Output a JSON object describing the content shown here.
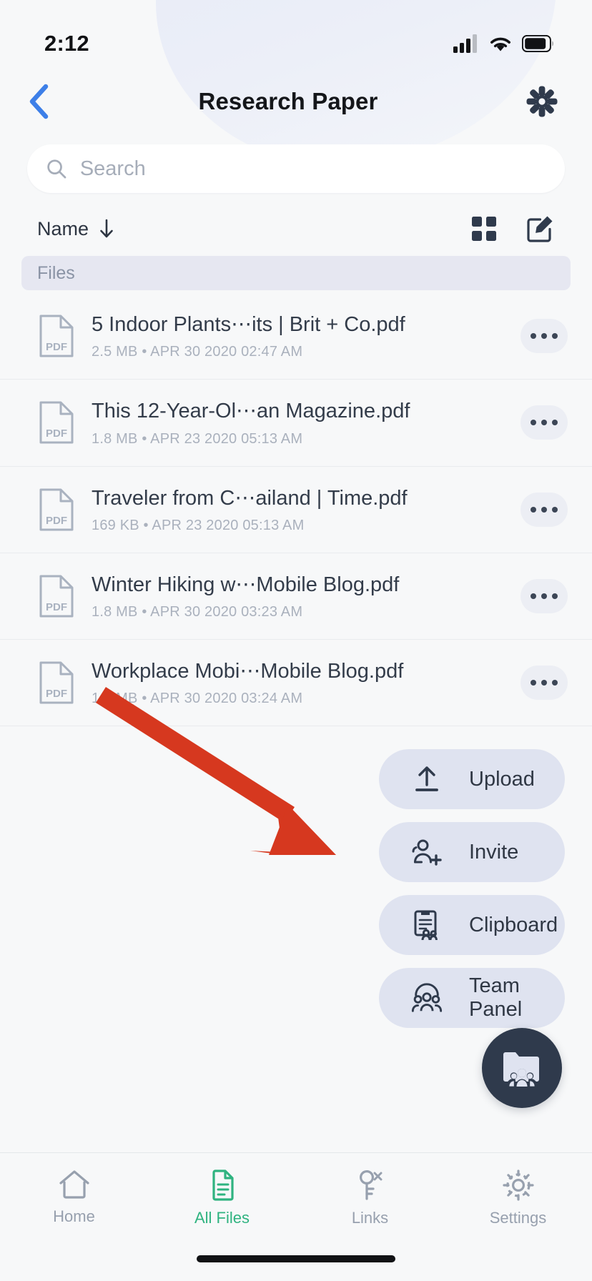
{
  "status_bar": {
    "time": "2:12",
    "cellular_icon": "cellular-signal-icon",
    "wifi_icon": "wifi-icon",
    "battery_icon": "battery-icon"
  },
  "nav": {
    "back_icon": "chevron-left-icon",
    "title": "Research Paper",
    "settings_icon": "gear-icon"
  },
  "search": {
    "placeholder": "Search",
    "value": "",
    "icon": "search-icon"
  },
  "toolbar": {
    "sort_label": "Name",
    "sort_direction_icon": "arrow-down-icon",
    "grid_view_icon": "grid-view-icon",
    "compose_icon": "compose-edit-icon"
  },
  "section": {
    "label": "Files"
  },
  "files": [
    {
      "name": "5 Indoor Plants⋯its | Brit + Co.pdf",
      "size": "2.5 MB",
      "date": "APR 30 2020 02:47 AM",
      "meta": "2.5 MB • APR 30 2020 02:47 AM",
      "type": "PDF",
      "icon": "pdf-file-icon",
      "more_icon": "more-options-icon"
    },
    {
      "name": "This 12-Year-Ol⋯an Magazine.pdf",
      "size": "1.8 MB",
      "date": "APR 23 2020 05:13 AM",
      "meta": "1.8 MB • APR 23 2020 05:13 AM",
      "type": "PDF",
      "icon": "pdf-file-icon",
      "more_icon": "more-options-icon"
    },
    {
      "name": "Traveler from C⋯ailand | Time.pdf",
      "size": "169 KB",
      "date": "APR 23 2020 05:13 AM",
      "meta": "169 KB • APR 23 2020 05:13 AM",
      "type": "PDF",
      "icon": "pdf-file-icon",
      "more_icon": "more-options-icon"
    },
    {
      "name": "Winter Hiking w⋯Mobile Blog.pdf",
      "size": "1.8 MB",
      "date": "APR 30 2020 03:23 AM",
      "meta": "1.8 MB • APR 30 2020 03:23 AM",
      "type": "PDF",
      "icon": "pdf-file-icon",
      "more_icon": "more-options-icon"
    },
    {
      "name": "Workplace Mobi⋯Mobile Blog.pdf",
      "size": "1.2 MB",
      "date": "APR 30 2020 03:24 AM",
      "meta": "1.2 MB • APR 30 2020 03:24 AM",
      "type": "PDF",
      "icon": "pdf-file-icon",
      "more_icon": "more-options-icon"
    }
  ],
  "actions": [
    {
      "label": "Upload",
      "icon": "upload-arrow-icon"
    },
    {
      "label": "Invite",
      "icon": "person-add-icon"
    },
    {
      "label": "Clipboard",
      "icon": "clipboard-people-icon"
    },
    {
      "label": "Team Panel",
      "icon": "team-group-icon"
    }
  ],
  "fab": {
    "icon": "shared-folder-team-icon"
  },
  "annotation": {
    "type": "arrow",
    "color": "#d6381f",
    "points_to": "Team Panel"
  },
  "tabs": [
    {
      "label": "Home",
      "icon": "home-icon",
      "active": false
    },
    {
      "label": "All Files",
      "icon": "files-document-icon",
      "active": true
    },
    {
      "label": "Links",
      "icon": "link-key-icon",
      "active": false
    },
    {
      "label": "Settings",
      "icon": "settings-gear-icon",
      "active": false
    }
  ],
  "colors": {
    "accent_green": "#2fb380",
    "back_blue": "#3d7fe8",
    "action_bg": "#dfe3f0",
    "fab_bg": "#2f3a4c",
    "annotation_red": "#d6381f"
  }
}
